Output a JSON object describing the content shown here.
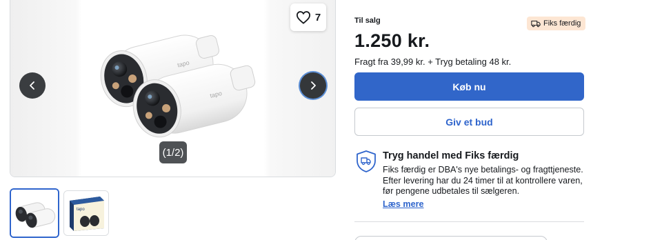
{
  "listing": {
    "status_label": "Til salg",
    "badge_label": "Fiks færdig",
    "price": "1.250 kr.",
    "shipping": "Fragt fra 39,99 kr. + Tryg betaling 48 kr."
  },
  "gallery": {
    "favorite_count": "7",
    "counter": "(1/2)",
    "image_brand": "tapo",
    "thumbnail_brand": "tapo"
  },
  "actions": {
    "buy_label": "Køb nu",
    "bid_label": "Giv et bud"
  },
  "safe_trade": {
    "title": "Tryg handel med Fiks færdig",
    "description": "Fiks færdig er DBA's nye betalings- og fragttjeneste. Efter levering har du 24 timer til at kontrollere varen, før pengene udbetales til sælgeren.",
    "link_label": "Læs mere"
  },
  "icons": {
    "favorite": "heart-icon",
    "previous": "chevron-left-icon",
    "next": "chevron-right-icon",
    "badge": "delivery-truck-icon",
    "safe_trade": "shield-truck-icon"
  },
  "colors": {
    "primary": "#3166c9",
    "link": "#2e64cc",
    "badge_bg": "#fde6d3",
    "nav_button": "#3a3d40"
  }
}
